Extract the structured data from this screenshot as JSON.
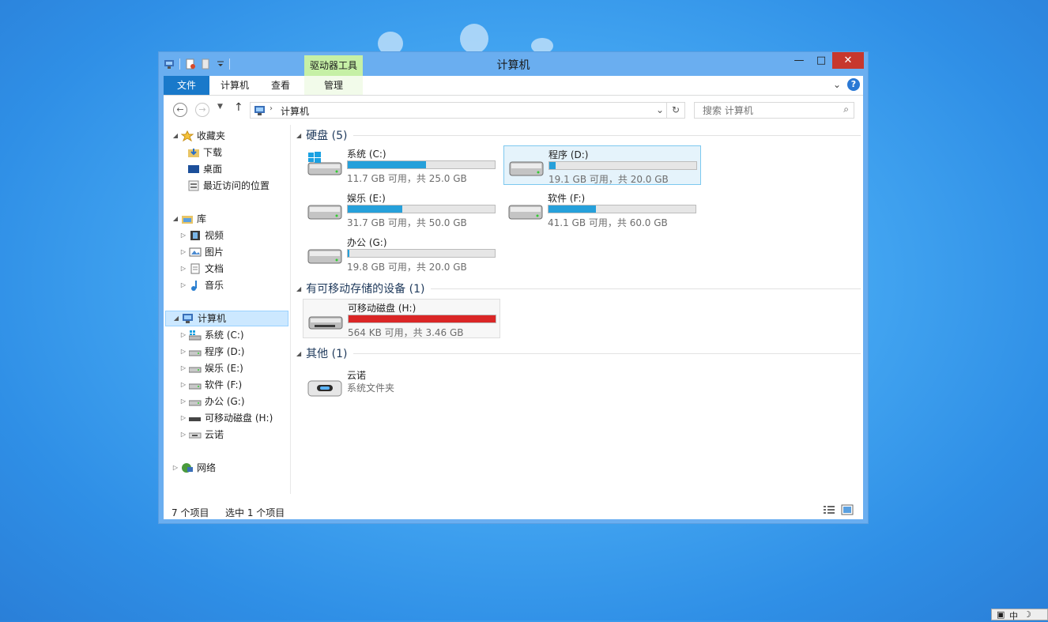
{
  "window": {
    "title": "计算机",
    "contextual_tab_group": "驱动器工具",
    "controls": {
      "minimize": "—",
      "maximize": "□",
      "close": "✕"
    }
  },
  "ribbon": {
    "tabs": [
      {
        "label": "文件",
        "active": true
      },
      {
        "label": "计算机"
      },
      {
        "label": "查看"
      },
      {
        "label": "管理"
      }
    ],
    "help": "?"
  },
  "address": {
    "path": [
      "计算机"
    ],
    "search_placeholder": "搜索 计算机"
  },
  "nav": {
    "favorites": {
      "label": "收藏夹",
      "items": [
        "下载",
        "桌面",
        "最近访问的位置"
      ]
    },
    "libraries": {
      "label": "库",
      "items": [
        "视频",
        "图片",
        "文档",
        "音乐"
      ]
    },
    "computer": {
      "label": "计算机",
      "items": [
        "系统 (C:)",
        "程序 (D:)",
        "娱乐 (E:)",
        "软件 (F:)",
        "办公 (G:)",
        "可移动磁盘 (H:)",
        "云诺"
      ]
    },
    "network": {
      "label": "网络"
    }
  },
  "groups": {
    "hdd": "硬盘 (5)",
    "removable": "有可移动存储的设备 (1)",
    "other": "其他 (1)"
  },
  "drives": [
    {
      "name": "系统 (C:)",
      "info": "11.7 GB 可用，共 25.0 GB",
      "used_fraction": 0.53
    },
    {
      "name": "程序 (D:)",
      "info": "19.1 GB 可用，共 20.0 GB",
      "used_fraction": 0.045
    },
    {
      "name": "娱乐 (E:)",
      "info": "31.7 GB 可用，共 50.0 GB",
      "used_fraction": 0.37
    },
    {
      "name": "软件 (F:)",
      "info": "41.1 GB 可用，共 60.0 GB",
      "used_fraction": 0.32
    },
    {
      "name": "办公 (G:)",
      "info": "19.8 GB 可用，共 20.0 GB",
      "used_fraction": 0.01
    }
  ],
  "removable": {
    "name": "可移动磁盘 (H:)",
    "info": "564 KB 可用，共 3.46 GB",
    "used_fraction": 0.999
  },
  "other": {
    "name": "云诺",
    "info": "系统文件夹"
  },
  "status": {
    "count": "7 个项目",
    "selected": "选中 1 个项目"
  },
  "ime": "中"
}
